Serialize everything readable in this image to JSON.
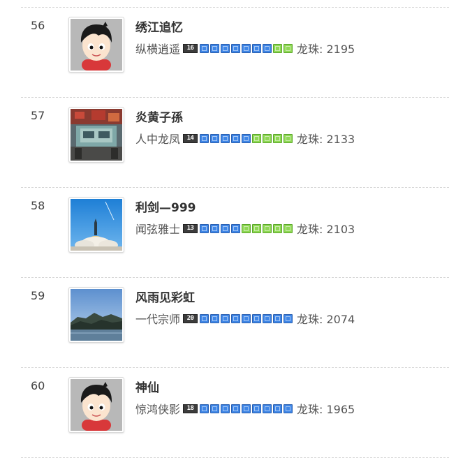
{
  "leaderboard": {
    "points_label": "龙珠: ",
    "rows": [
      {
        "rank": "56",
        "name": "绣江追忆",
        "title": "纵横逍遥",
        "level": "16",
        "avatar_icon": "cartoon-boy-avatar",
        "pips": [
          "blue",
          "blue",
          "blue",
          "blue",
          "blue",
          "blue",
          "blue",
          "green",
          "green"
        ],
        "points": "2195"
      },
      {
        "rank": "57",
        "name": "炎黄子孫",
        "title": "人中龙凤",
        "level": "14",
        "avatar_icon": "street-photo-avatar",
        "pips": [
          "blue",
          "blue",
          "blue",
          "blue",
          "blue",
          "green",
          "green",
          "green",
          "green"
        ],
        "points": "2133"
      },
      {
        "rank": "58",
        "name": "利剑—999",
        "title": "闻弦雅士",
        "level": "13",
        "avatar_icon": "rocket-launch-avatar",
        "pips": [
          "blue",
          "blue",
          "blue",
          "blue",
          "green",
          "green",
          "green",
          "green",
          "green"
        ],
        "points": "2103"
      },
      {
        "rank": "59",
        "name": "风雨见彩虹",
        "title": "一代宗师",
        "level": "20",
        "avatar_icon": "mountain-lake-avatar",
        "pips": [
          "blue",
          "blue",
          "blue",
          "blue",
          "blue",
          "blue",
          "blue",
          "blue",
          "blue"
        ],
        "points": "2074"
      },
      {
        "rank": "60",
        "name": "神仙",
        "title": "惊鸿侠影",
        "level": "18",
        "avatar_icon": "cartoon-boy-avatar",
        "pips": [
          "blue",
          "blue",
          "blue",
          "blue",
          "blue",
          "blue",
          "blue",
          "blue",
          "blue"
        ],
        "points": "1965"
      }
    ]
  }
}
